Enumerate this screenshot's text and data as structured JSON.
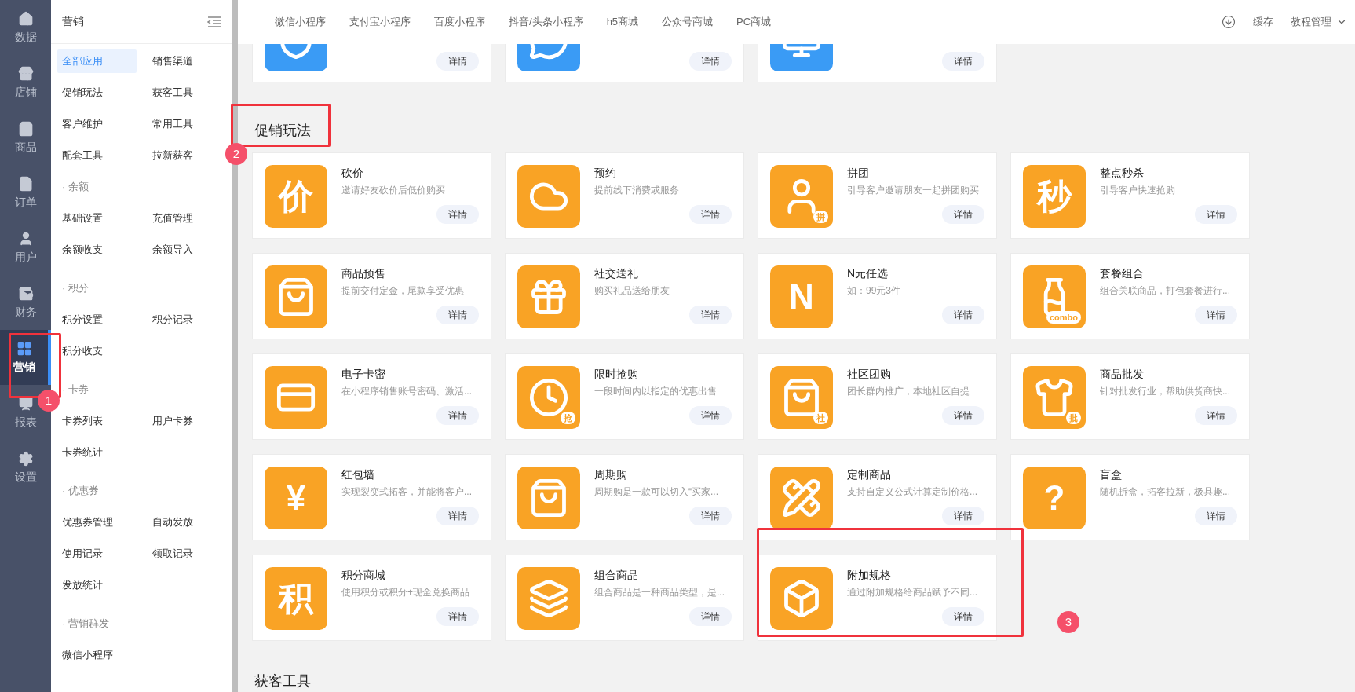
{
  "rail": [
    {
      "label": "数据",
      "selected": false
    },
    {
      "label": "店铺",
      "selected": false
    },
    {
      "label": "商品",
      "selected": false
    },
    {
      "label": "订单",
      "selected": false
    },
    {
      "label": "用户",
      "selected": false
    },
    {
      "label": "财务",
      "selected": false
    },
    {
      "label": "营销",
      "selected": true
    },
    {
      "label": "报表",
      "selected": false
    },
    {
      "label": "设置",
      "selected": false
    }
  ],
  "submenu": {
    "title": "营销",
    "groups": [
      {
        "items": [
          {
            "label": "全部应用",
            "selected": true
          },
          {
            "label": "销售渠道",
            "selected": false
          },
          {
            "label": "促销玩法",
            "selected": false
          },
          {
            "label": "获客工具",
            "selected": false
          },
          {
            "label": "客户维护",
            "selected": false
          },
          {
            "label": "常用工具",
            "selected": false
          },
          {
            "label": "配套工具",
            "selected": false
          },
          {
            "label": "拉新获客",
            "selected": false
          }
        ]
      },
      {
        "heading": "· 余额",
        "items": [
          {
            "label": "基础设置",
            "selected": false
          },
          {
            "label": "充值管理",
            "selected": false
          },
          {
            "label": "余额收支",
            "selected": false
          },
          {
            "label": "余额导入",
            "selected": false
          }
        ]
      },
      {
        "heading": "· 积分",
        "items": [
          {
            "label": "积分设置",
            "selected": false
          },
          {
            "label": "积分记录",
            "selected": false
          },
          {
            "label": "积分收支",
            "selected": false
          }
        ]
      },
      {
        "heading": "· 卡券",
        "items": [
          {
            "label": "卡券列表",
            "selected": false
          },
          {
            "label": "用户卡券",
            "selected": false
          },
          {
            "label": "卡券统计",
            "selected": false
          }
        ]
      },
      {
        "heading": "· 优惠券",
        "items": [
          {
            "label": "优惠券管理",
            "selected": false
          },
          {
            "label": "自动发放",
            "selected": false
          },
          {
            "label": "使用记录",
            "selected": false
          },
          {
            "label": "领取记录",
            "selected": false
          },
          {
            "label": "发放统计",
            "selected": false
          }
        ]
      },
      {
        "heading": "· 营销群发",
        "items": [
          {
            "label": "微信小程序",
            "selected": false
          }
        ]
      }
    ]
  },
  "channel_tabs": [
    "微信小程序",
    "支付宝小程序",
    "百度小程序",
    "抖音/头条小程序",
    "h5商城",
    "公众号商城",
    "PC商城"
  ],
  "top_actions": {
    "cache": "缓存",
    "tutorial": "教程管理"
  },
  "top_cards": [
    {
      "button": "详情"
    },
    {
      "button": "详情"
    },
    {
      "button": "详情"
    }
  ],
  "section": {
    "title": "促销玩法",
    "cards": [
      {
        "title": "砍价",
        "desc": "邀请好友砍价后低价购买",
        "kind": "glyph",
        "icon_text": "价",
        "button": "详情"
      },
      {
        "title": "预约",
        "desc": "提前线下消费或服务",
        "kind": "drawing",
        "button": "详情"
      },
      {
        "title": "拼团",
        "desc": "引导客户邀请朋友一起拼团购买",
        "kind": "drawing",
        "icon_text": "拼",
        "button": "详情"
      },
      {
        "title": "整点秒杀",
        "desc": "引导客户快速抢购",
        "kind": "glyph",
        "icon_text": "秒",
        "button": "详情"
      },
      {
        "title": "商品预售",
        "desc": "提前交付定金，尾款享受优惠",
        "kind": "drawing",
        "button": "详情"
      },
      {
        "title": "社交送礼",
        "desc": "购买礼品送给朋友",
        "kind": "drawing",
        "button": "详情"
      },
      {
        "title": "N元任选",
        "desc": "如：99元3件",
        "kind": "glyph",
        "icon_text": "N",
        "button": "详情"
      },
      {
        "title": "套餐组合",
        "desc": "组合关联商品，打包套餐进行...",
        "kind": "drawing",
        "icon_text": "combo",
        "button": "详情"
      },
      {
        "title": "电子卡密",
        "desc": "在小程序销售账号密码、激活...",
        "kind": "drawing",
        "button": "详情"
      },
      {
        "title": "限时抢购",
        "desc": "一段时间内以指定的优惠出售",
        "kind": "drawing",
        "icon_text": "抢",
        "button": "详情"
      },
      {
        "title": "社区团购",
        "desc": "团长群内推广，本地社区自提",
        "kind": "drawing",
        "icon_text": "社",
        "button": "详情"
      },
      {
        "title": "商品批发",
        "desc": "针对批发行业，帮助供货商快...",
        "kind": "drawing",
        "icon_text": "批",
        "button": "详情"
      },
      {
        "title": "红包墙",
        "desc": "实现裂变式拓客，并能将客户...",
        "kind": "glyph",
        "icon_text": "¥",
        "button": "详情"
      },
      {
        "title": "周期购",
        "desc": "周期购是一款可以切入“买家...",
        "kind": "drawing",
        "button": "详情"
      },
      {
        "title": "定制商品",
        "desc": "支持自定义公式计算定制价格...",
        "kind": "drawing",
        "button": "详情"
      },
      {
        "title": "盲盒",
        "desc": "随机拆盒，拓客拉新，极具趣...",
        "kind": "glyph",
        "icon_text": "?",
        "button": "详情"
      },
      {
        "title": "积分商城",
        "desc": "使用积分或积分+现金兑换商品",
        "kind": "glyph",
        "icon_text": "积",
        "button": "详情"
      },
      {
        "title": "组合商品",
        "desc": "组合商品是一种商品类型，是...",
        "kind": "drawing",
        "button": "详情"
      },
      {
        "title": "附加规格",
        "desc": "通过附加规格给商品赋予不同...",
        "kind": "drawing",
        "button": "详情"
      }
    ]
  },
  "next_section": {
    "title": "获客工具"
  },
  "annotations": [
    {
      "label": "1"
    },
    {
      "label": "2"
    },
    {
      "label": "3"
    }
  ]
}
